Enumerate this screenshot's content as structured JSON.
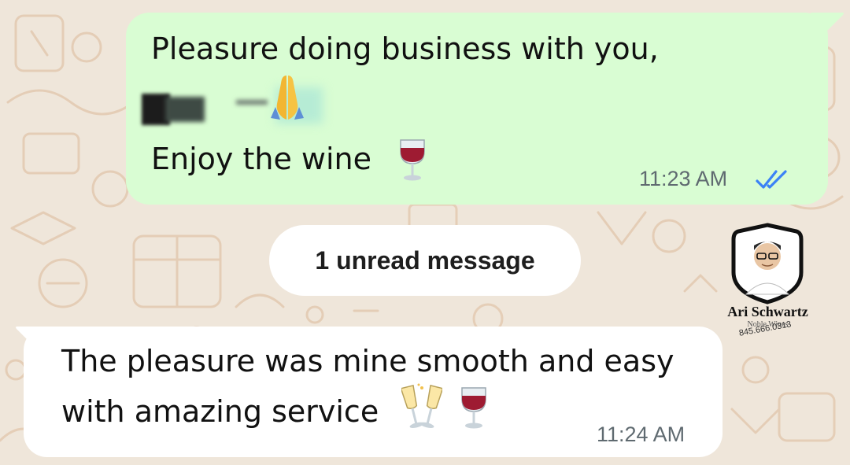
{
  "colors": {
    "background": "#efe6da",
    "outgoing_bubble": "#d9fdd3",
    "incoming_bubble": "#ffffff",
    "read_ticks": "#3b82f6",
    "timestamp": "#5f6a70"
  },
  "outgoing_message": {
    "line1": "Pleasure doing business with you,",
    "line3": "Enjoy the wine",
    "line2_emoji": "folded-hands-icon",
    "line3_emoji": "wine-glass-icon",
    "time": "11:23 AM",
    "status_icon": "double-check-read-icon"
  },
  "unread_divider": {
    "label": "1 unread message"
  },
  "incoming_message": {
    "line1": "The pleasure was mine smooth and easy",
    "line2": "with amazing service",
    "emojis": [
      "clinking-glasses-icon",
      "wine-glass-icon"
    ],
    "time": "11:24 AM"
  },
  "watermark": {
    "name": "Ari Schwartz",
    "subtitle": "Noble Wines",
    "phone": "845.666.0313"
  }
}
